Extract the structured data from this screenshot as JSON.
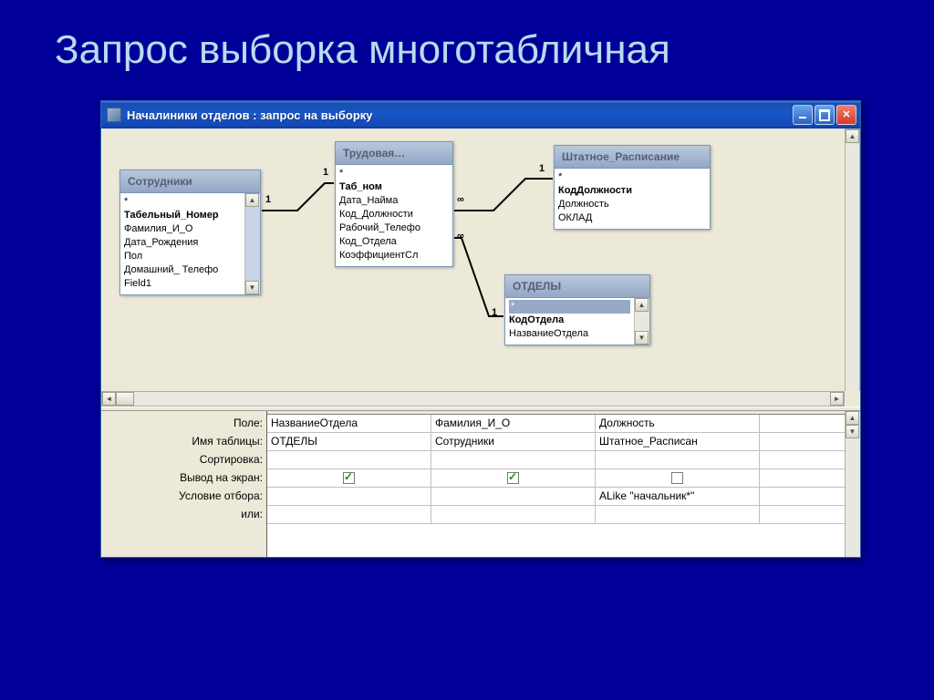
{
  "slide": {
    "title": "Запрос выборка многотабличная"
  },
  "window": {
    "title": "Началиники отделов : запрос на выборку"
  },
  "tables": {
    "employees": {
      "title": "Сотрудники",
      "fields": [
        "*",
        "Табельный_Номер",
        "Фамилия_И_О",
        "Дата_Рождения",
        "Пол",
        "Домашний_ Телефо",
        "Field1"
      ],
      "bold_index": 1
    },
    "labor": {
      "title": "Трудовая…",
      "fields": [
        "*",
        "Таб_ном",
        "Дата_Найма",
        "Код_Должности",
        "Рабочий_Телефо",
        "Код_Отдела",
        "КоэффициентСл"
      ],
      "bold_index": 1
    },
    "staffing": {
      "title": "Штатное_Расписание",
      "fields": [
        "*",
        "КодДолжности",
        "Должность",
        "ОКЛАД"
      ],
      "bold_index": 1
    },
    "departments": {
      "title": "ОТДЕЛЫ",
      "fields": [
        "*",
        "КодОтдела",
        "НазваниеОтдела"
      ],
      "bold_index": 1,
      "selected_index": 0
    }
  },
  "relations": {
    "r1_left": "1",
    "r1_right": "1",
    "r2_left": "∞",
    "r2_right": "1",
    "r3_left": "∞",
    "r3_right": "1"
  },
  "grid": {
    "labels": {
      "field": "Поле:",
      "table": "Имя таблицы:",
      "sort": "Сортировка:",
      "show": "Вывод на экран:",
      "criteria": "Условие отбора:",
      "or": "или:"
    },
    "columns": [
      {
        "field": "НазваниеОтдела",
        "table": "ОТДЕЛЫ",
        "sort": "",
        "show": true,
        "criteria": "",
        "or": ""
      },
      {
        "field": "Фамилия_И_О",
        "table": "Сотрудники",
        "sort": "",
        "show": true,
        "criteria": "",
        "or": ""
      },
      {
        "field": "Должность",
        "table": "Штатное_Расписан",
        "sort": "",
        "show": false,
        "criteria": "ALike \"начальник*\"",
        "or": ""
      }
    ]
  }
}
